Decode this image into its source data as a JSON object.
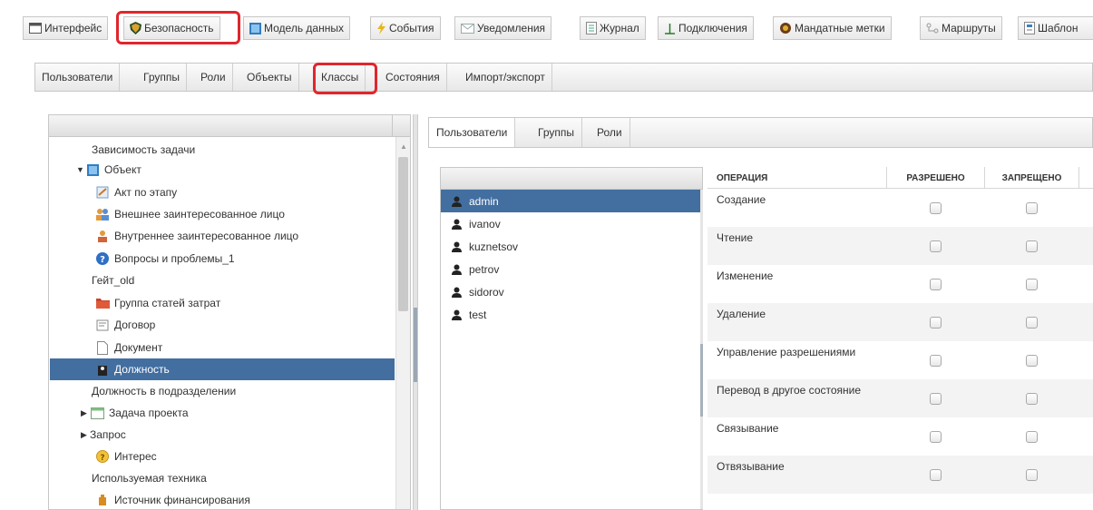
{
  "toolbar": {
    "items": [
      {
        "label": "Интерфейс",
        "icon": "window-icon"
      },
      {
        "label": "Безопасность",
        "icon": "shield-icon"
      },
      {
        "label": "Модель данных",
        "icon": "data-model-icon"
      },
      {
        "label": "События",
        "icon": "lightning-icon"
      },
      {
        "label": "Уведомления",
        "icon": "envelope-icon"
      },
      {
        "label": "Журнал",
        "icon": "journal-icon"
      },
      {
        "label": "Подключения",
        "icon": "connection-icon"
      },
      {
        "label": "Мандатные метки",
        "icon": "label-icon"
      },
      {
        "label": "Маршруты",
        "icon": "routes-icon"
      },
      {
        "label": "Шаблон",
        "icon": "template-icon"
      }
    ]
  },
  "subtabs": {
    "items": [
      "Пользователи",
      "Группы",
      "Роли",
      "Объекты",
      "Классы",
      "Состояния",
      "Импорт/экспорт"
    ]
  },
  "tree": {
    "items": [
      {
        "label": "Зависимость задачи",
        "icon": ""
      },
      {
        "label": "Объект",
        "icon": "class-icon",
        "arrow": "▼"
      },
      {
        "label": "Акт по этапу",
        "icon": "act-icon"
      },
      {
        "label": "Внешнее заинтересованное лицо",
        "icon": "people-icon"
      },
      {
        "label": "Внутреннее заинтересованное лицо",
        "icon": "person-icon"
      },
      {
        "label": "Вопросы и проблемы_1",
        "icon": "question-icon"
      },
      {
        "label": "Гейт_old",
        "icon": ""
      },
      {
        "label": "Группа статей затрат",
        "icon": "folder-icon"
      },
      {
        "label": "Договор",
        "icon": "contract-icon"
      },
      {
        "label": "Документ",
        "icon": "document-icon"
      },
      {
        "label": "Должность",
        "icon": "position-icon"
      },
      {
        "label": "Должность в подразделении",
        "icon": ""
      },
      {
        "label": "Задача проекта",
        "icon": "task-icon",
        "arrow": "▶"
      },
      {
        "label": "Запрос",
        "icon": "",
        "arrow": "▶"
      },
      {
        "label": "Интерес",
        "icon": "interest-icon"
      },
      {
        "label": "Используемая техника",
        "icon": ""
      },
      {
        "label": "Источник финансирования",
        "icon": "money-icon"
      }
    ]
  },
  "right_tabs": {
    "items": [
      "Пользователи",
      "Группы",
      "Роли"
    ]
  },
  "users": {
    "items": [
      "admin",
      "ivanov",
      "kuznetsov",
      "petrov",
      "sidorov",
      "test"
    ]
  },
  "ops": {
    "header": {
      "operation": "ОПЕРАЦИЯ",
      "allowed": "РАЗРЕШЕНО",
      "denied": "ЗАПРЕЩЕНО"
    },
    "rows": [
      "Создание",
      "Чтение",
      "Изменение",
      "Удаление",
      "Управление разрешениями",
      "Перевод в другое состояние",
      "Связывание",
      "Отвязывание"
    ]
  },
  "colors": {
    "selection": "#426ea0",
    "highlight": "#e0262d"
  }
}
